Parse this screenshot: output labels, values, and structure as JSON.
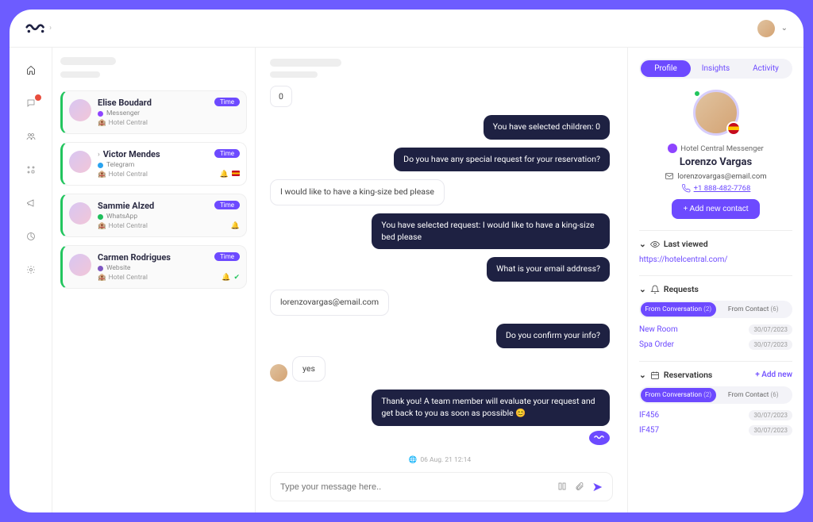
{
  "conversations": [
    {
      "name": "Elise Boudard",
      "channel": "Messenger",
      "channel_dot": "mess",
      "hotel": "Hotel Central",
      "time": "Time"
    },
    {
      "name": "Victor Mendes",
      "channel": "Telegram",
      "channel_dot": "tele",
      "hotel": "Hotel Central",
      "time": "Time",
      "chev": true,
      "bell": true,
      "flag": true
    },
    {
      "name": "Sammie Alzed",
      "channel": "WhatsApp",
      "channel_dot": "wa",
      "hotel": "Hotel Central",
      "time": "Time",
      "bell": true
    },
    {
      "name": "Carmen Rodrigues",
      "channel": "Website",
      "channel_dot": "web",
      "hotel": "Hotel Central",
      "time": "Time",
      "bell": true,
      "check": true
    }
  ],
  "chat": {
    "messages": [
      {
        "side": "in",
        "text": "0",
        "plain": true
      },
      {
        "side": "out",
        "text": "You have selected children: 0"
      },
      {
        "side": "out",
        "text": "Do you have any special request for your reservation?"
      },
      {
        "side": "in",
        "text": "I would like to have a king-size bed please"
      },
      {
        "side": "out",
        "text": "You have selected request: I would like to have a king-size bed please"
      },
      {
        "side": "out",
        "text": "What is your email address?"
      },
      {
        "side": "in",
        "text": "lorenzovargas@email.com"
      },
      {
        "side": "out",
        "text": "Do you confirm your info?"
      },
      {
        "side": "in",
        "text": "yes",
        "avatar": true
      },
      {
        "side": "out",
        "text": "Thank you! A team member will evaluate your request and get back to you as soon as possible 😊",
        "brand": true
      }
    ],
    "timestamp": "06 Aug. 21 12:14",
    "placeholder": "Type your message here.."
  },
  "profile": {
    "tabs": {
      "profile": "Profile",
      "insights": "Insights",
      "activity": "Activity"
    },
    "channel_line": "Hotel Central Messenger",
    "name": "Lorenzo Vargas",
    "email": "lorenzovargas@email.com",
    "phone": "+1 888-482-7768",
    "add_contact": "+  Add new contact",
    "last_viewed": {
      "title": "Last viewed",
      "url": "https://hotelcentral.com/"
    },
    "requests": {
      "title": "Requests",
      "tab_conv": "From Conversation",
      "tab_conv_count": "(2)",
      "tab_contact": "From Contact",
      "tab_contact_count": "(6)",
      "items": [
        {
          "name": "New Room",
          "date": "30/07/2023"
        },
        {
          "name": "Spa Order",
          "date": "30/07/2023"
        }
      ]
    },
    "reservations": {
      "title": "Reservations",
      "add_new": "+  Add new",
      "tab_conv": "From Conversation",
      "tab_conv_count": "(2)",
      "tab_contact": "From Contact",
      "tab_contact_count": "(6)",
      "items": [
        {
          "name": "IF456",
          "date": "30/07/2023"
        },
        {
          "name": "IF457",
          "date": "30/07/2023"
        }
      ]
    }
  }
}
